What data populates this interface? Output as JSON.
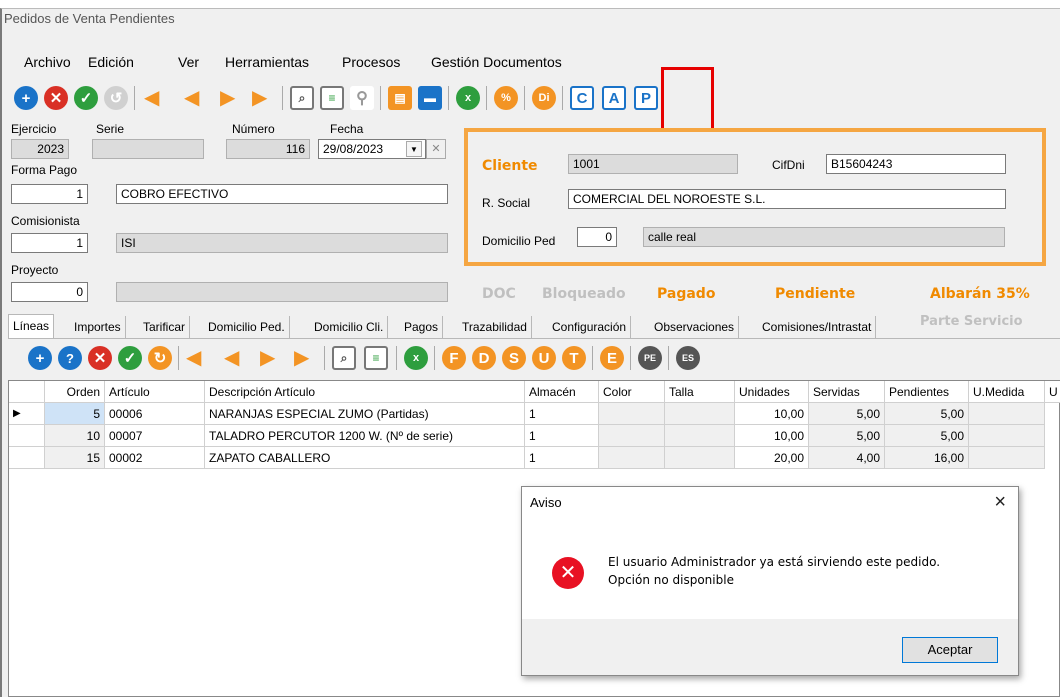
{
  "window": {
    "title": "Pedidos de Venta Pendientes"
  },
  "menu": [
    "Archivo",
    "Edición",
    "Ver",
    "Herramientas",
    "Procesos",
    "Gestión Documentos"
  ],
  "toolbar_icons": [
    "add-icon",
    "delete-icon",
    "accept-icon",
    "undo-icon",
    "first-icon",
    "prev-icon",
    "next-icon",
    "last-icon",
    "search-icon",
    "filter-icon",
    "binoculars-icon",
    "copy-icon",
    "print-icon",
    "excel-icon",
    "discount-icon",
    "di-icon",
    "doc-c-icon",
    "doc-a-icon",
    "doc-p-icon"
  ],
  "form": {
    "ejercicio_label": "Ejercicio",
    "ejercicio": "2023",
    "serie_label": "Serie",
    "serie": "",
    "numero_label": "Número",
    "numero": "116",
    "fecha_label": "Fecha",
    "fecha": "29/08/2023",
    "formapago_label": "Forma Pago",
    "formapago_code": "1",
    "formapago_desc": "COBRO EFECTIVO",
    "comisionista_label": "Comisionista",
    "comisionista_code": "1",
    "comisionista_desc": "ISI",
    "proyecto_label": "Proyecto",
    "proyecto_code": "0",
    "proyecto_desc": ""
  },
  "cliente": {
    "cliente_label": "Cliente",
    "cliente": "1001",
    "cifdni_label": "CifDni",
    "cifdni": "B15604243",
    "rsocial_label": "R. Social",
    "rsocial": "COMERCIAL DEL NOROESTE S.L.",
    "domicilio_label": "Domicilio Ped",
    "domicilio_code": "0",
    "domicilio_desc": "calle real"
  },
  "status": {
    "doc": "DOC",
    "bloqueado": "Bloqueado",
    "pagado": "Pagado",
    "pendiente": "Pendiente",
    "albaran": "Albarán 35%",
    "parte": "Parte Servicio"
  },
  "tabs": [
    "Líneas",
    "Importes",
    "Tarificar",
    "Domicilio Ped.",
    "Domicilio Cli.",
    "Pagos",
    "Trazabilidad",
    "Configuración",
    "Observaciones",
    "Comisiones/Intrastat"
  ],
  "grid": {
    "headers": [
      "Orden",
      "Artículo",
      "Descripción Artículo",
      "Almacén",
      "Color",
      "Talla",
      "Unidades",
      "Servidas",
      "Pendientes",
      "U.Medida",
      "U"
    ],
    "rows": [
      {
        "orden": "5",
        "articulo": "00006",
        "desc": "NARANJAS ESPECIAL ZUMO (Partidas)",
        "almacen": "1",
        "color": "",
        "talla": "",
        "unidades": "10,00",
        "servidas": "5,00",
        "pendientes": "5,00",
        "umedida": ""
      },
      {
        "orden": "10",
        "articulo": "00007",
        "desc": "TALADRO PERCUTOR 1200 W. (Nº de serie)",
        "almacen": "1",
        "color": "",
        "talla": "",
        "unidades": "10,00",
        "servidas": "5,00",
        "pendientes": "5,00",
        "umedida": ""
      },
      {
        "orden": "15",
        "articulo": "00002",
        "desc": "ZAPATO CABALLERO",
        "almacen": "1",
        "color": "",
        "talla": "",
        "unidades": "20,00",
        "servidas": "4,00",
        "pendientes": "16,00",
        "umedida": ""
      }
    ]
  },
  "dialog": {
    "title": "Aviso",
    "close": "×",
    "message_line1": "El usuario Administrador ya está sirviendo este pedido.",
    "message_line2": "Opción no disponible",
    "button": "Aceptar"
  },
  "colors": {
    "accent_orange": "#f5a642",
    "status_orange": "#f08a00",
    "highlight_red": "#e60000",
    "blue": "#1a73c8",
    "green": "#2e9e3e",
    "red": "#d93025"
  }
}
